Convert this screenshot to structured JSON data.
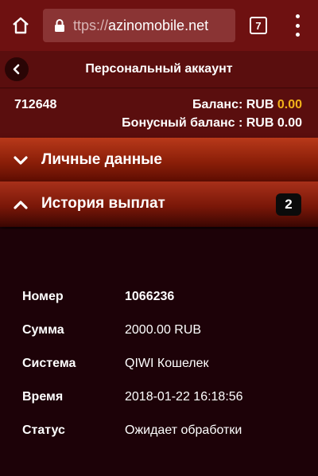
{
  "browser": {
    "url_prefix": "ttps://",
    "url_host": "azinomobile.net",
    "tab_count": "7"
  },
  "header": {
    "title": "Персональный аккаунт"
  },
  "account": {
    "id": "712648",
    "balance_label": "Баланс: RUB",
    "balance_value": "0.00",
    "bonus_label": "Бонусный баланс : RUB",
    "bonus_value": "0.00"
  },
  "sections": {
    "personal": {
      "label": "Личные данные"
    },
    "history": {
      "label": "История выплат",
      "badge": "2"
    }
  },
  "payout": {
    "number_label": "Номер",
    "number_value": "1066236",
    "amount_label": "Сумма",
    "amount_value": "2000.00 RUB",
    "system_label": "Система",
    "system_value": "QIWI Кошелек",
    "time_label": "Время",
    "time_value": "2018-01-22 16:18:56",
    "status_label": "Статус",
    "status_value": "Ожидает обработки"
  },
  "colors": {
    "chrome": "#6e1111",
    "header": "#5a0e0e",
    "accent_yellow": "#f2b31a",
    "background": "#1d0208"
  }
}
